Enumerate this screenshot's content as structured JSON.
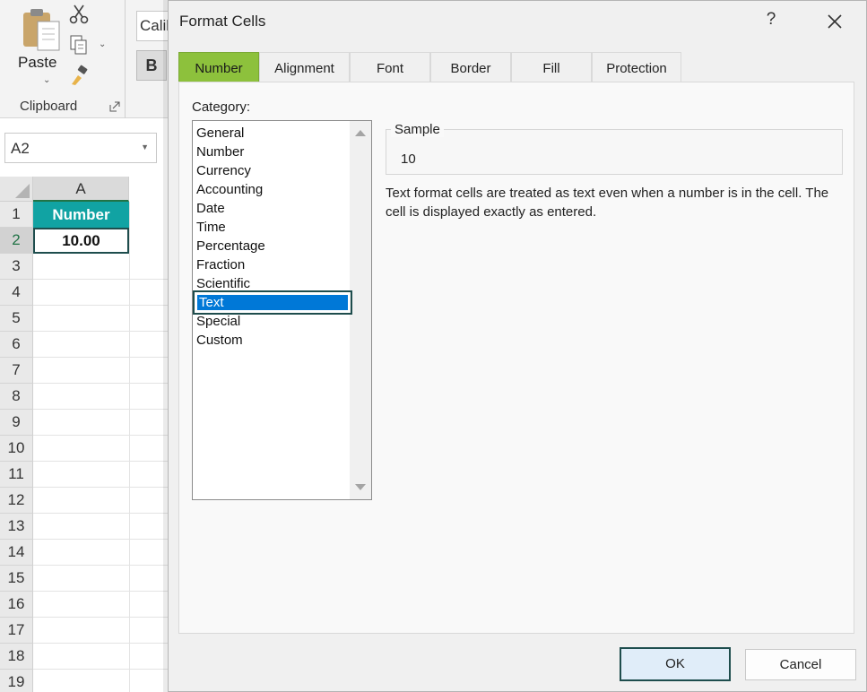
{
  "ribbon": {
    "paste_label": "Paste",
    "clipboard_label": "Clipboard",
    "font_name": "Calibri",
    "bold_label": "B"
  },
  "name_box": {
    "value": "A2"
  },
  "sheet": {
    "column_header": "A",
    "rows": [
      "1",
      "2",
      "3",
      "4",
      "5",
      "6",
      "7",
      "8",
      "9",
      "10",
      "11",
      "12",
      "13",
      "14",
      "15",
      "16",
      "17",
      "18",
      "19"
    ],
    "cell_a1": "Number",
    "cell_a2": "10.00",
    "header_color": "#11a3a3"
  },
  "dialog": {
    "title": "Format Cells",
    "help": "?",
    "tabs": [
      "Number",
      "Alignment",
      "Font",
      "Border",
      "Fill",
      "Protection"
    ],
    "active_tab": "Number",
    "category_label": "Category:",
    "categories": [
      "General",
      "Number",
      "Currency",
      "Accounting",
      "Date",
      "Time",
      "Percentage",
      "Fraction",
      "Scientific",
      "Text",
      "Special",
      "Custom"
    ],
    "selected_category": "Text",
    "sample_label": "Sample",
    "sample_value": "10",
    "description": "Text format cells are treated as text even when a number is in the cell.  The cell is displayed exactly as entered.",
    "ok_label": "OK",
    "cancel_label": "Cancel",
    "accent_color": "#8dc13c",
    "selection_color": "#0078d7"
  }
}
